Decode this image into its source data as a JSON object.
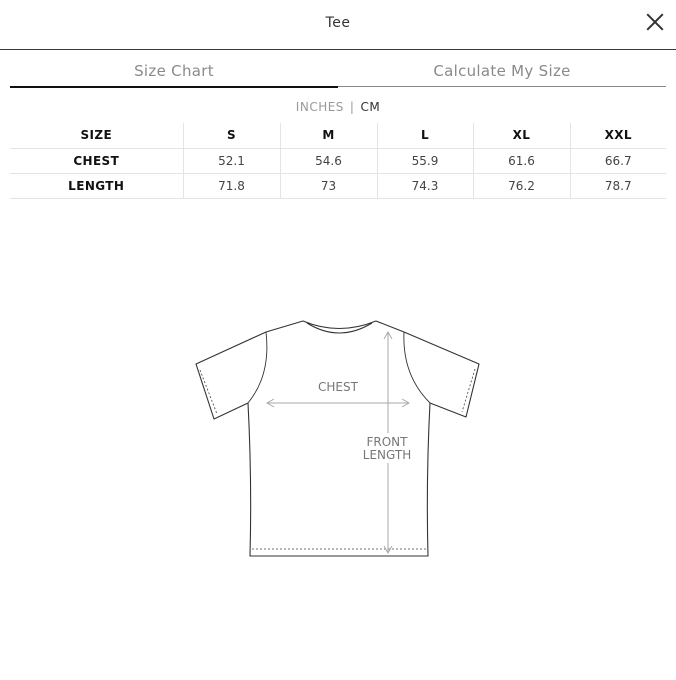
{
  "header": {
    "title": "Tee"
  },
  "tabs": [
    {
      "label": "Size Chart",
      "active": true
    },
    {
      "label": "Calculate My Size",
      "active": false
    }
  ],
  "units": {
    "inches": "INCHES",
    "separator": "|",
    "cm": "CM",
    "selected": "CM"
  },
  "table": {
    "columns": [
      "SIZE",
      "S",
      "M",
      "L",
      "XL",
      "XXL"
    ],
    "rows": [
      {
        "label": "CHEST",
        "values": [
          "52.1",
          "54.6",
          "55.9",
          "61.6",
          "66.7"
        ]
      },
      {
        "label": "LENGTH",
        "values": [
          "71.8",
          "73",
          "74.3",
          "76.2",
          "78.7"
        ]
      }
    ]
  },
  "diagram": {
    "chest_label": "CHEST",
    "length_label_line1": "FRONT",
    "length_label_line2": "LENGTH"
  },
  "colors": {
    "text": "#222222",
    "muted": "#8a8a8a",
    "divider": "#e4e4e4",
    "accent": "#111111"
  },
  "icons": {
    "close": "close-icon",
    "shirt": "tshirt-diagram-icon"
  }
}
